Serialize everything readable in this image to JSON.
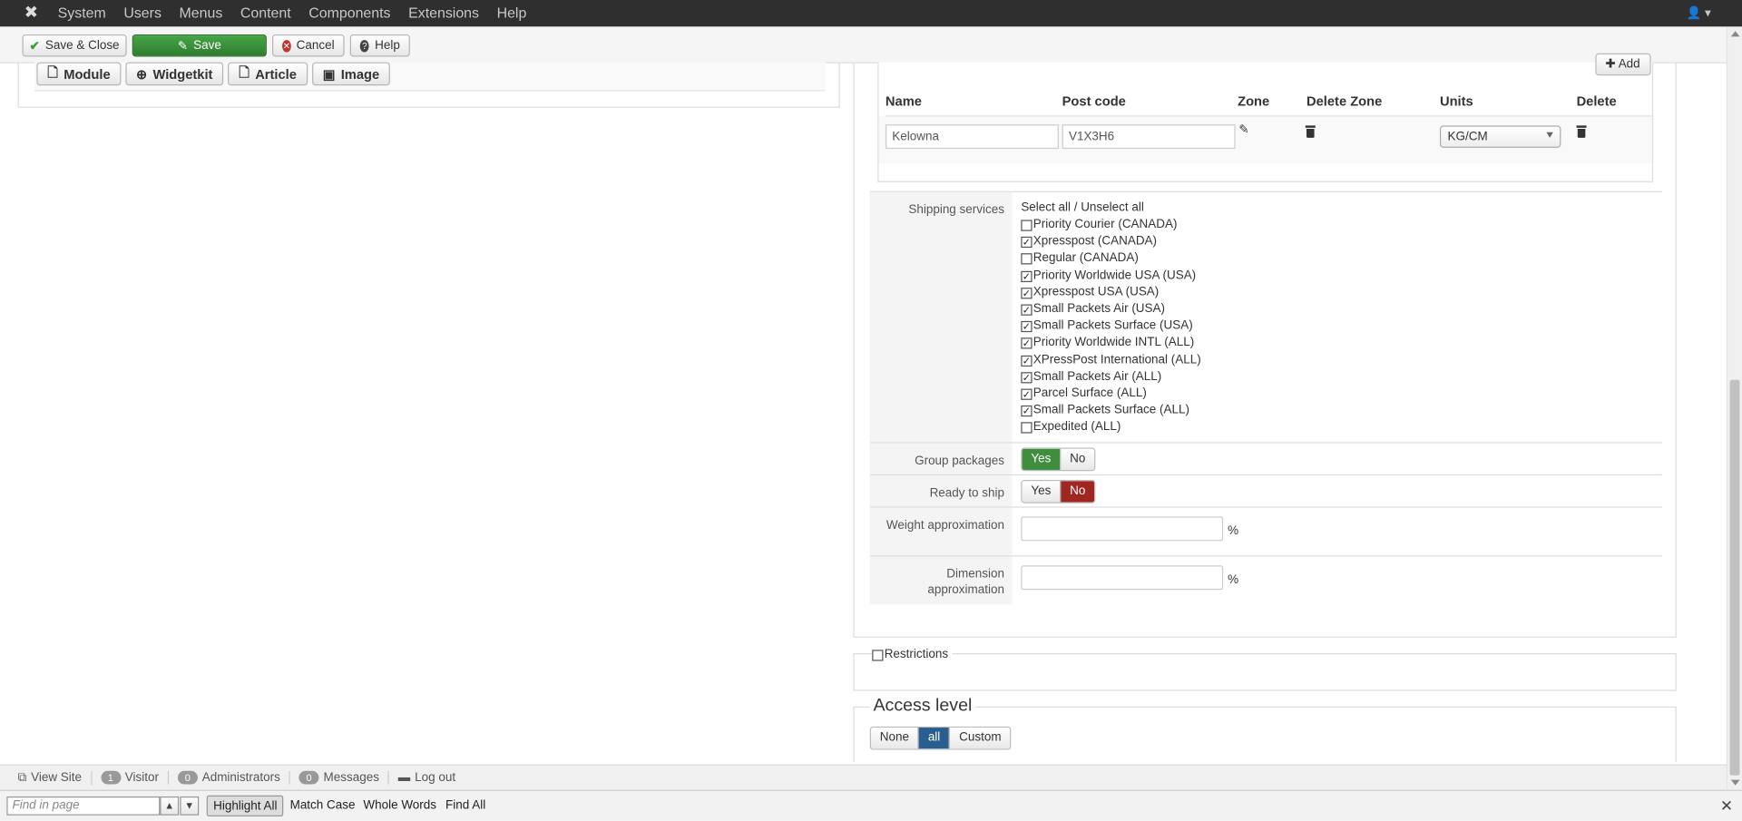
{
  "navbar": {
    "logo_glyph": "✖",
    "menu": [
      "System",
      "Users",
      "Menus",
      "Content",
      "Components",
      "Extensions",
      "Help"
    ],
    "user_glyph": "👤 ▾"
  },
  "toolbar": {
    "save_close": "Save & Close",
    "save": "Save",
    "cancel": "Cancel",
    "help": "Help"
  },
  "editor_buttons": [
    "Module",
    "Widgetkit",
    "Article",
    "Image"
  ],
  "zones": {
    "add_label": "Add",
    "headers": [
      "Name",
      "Post code",
      "Zone",
      "Delete Zone",
      "Units",
      "Delete"
    ],
    "row": {
      "name": "Kelowna",
      "postcode": "V1X3H6",
      "units": "KG/CM"
    }
  },
  "shipping": {
    "label": "Shipping services",
    "select_all": "Select all / Unselect all",
    "services": [
      {
        "label": "Priority Courier (CANADA)",
        "checked": false
      },
      {
        "label": "Xpresspost (CANADA)",
        "checked": true
      },
      {
        "label": "Regular (CANADA)",
        "checked": false
      },
      {
        "label": "Priority Worldwide USA (USA)",
        "checked": true
      },
      {
        "label": "Xpresspost USA (USA)",
        "checked": true
      },
      {
        "label": "Small Packets Air (USA)",
        "checked": true
      },
      {
        "label": "Small Packets Surface (USA)",
        "checked": true
      },
      {
        "label": "Priority Worldwide INTL (ALL)",
        "checked": true
      },
      {
        "label": "XPressPost International (ALL)",
        "checked": true
      },
      {
        "label": "Small Packets Air (ALL)",
        "checked": true
      },
      {
        "label": "Parcel Surface (ALL)",
        "checked": true
      },
      {
        "label": "Small Packets Surface (ALL)",
        "checked": true
      },
      {
        "label": "Expedited (ALL)",
        "checked": false
      }
    ]
  },
  "group_packages": {
    "label": "Group packages",
    "yes": "Yes",
    "no": "No",
    "selected": "Yes"
  },
  "ready_to_ship": {
    "label": "Ready to ship",
    "yes": "Yes",
    "no": "No",
    "selected": "No"
  },
  "weight_approx": {
    "label": "Weight approximation",
    "value": "",
    "unit": "%"
  },
  "dimension_approx": {
    "label": "Dimension approximation",
    "value": "",
    "unit": "%"
  },
  "restrictions": {
    "label": "Restrictions",
    "checked": false
  },
  "access_level": {
    "title": "Access level",
    "options": [
      "None",
      "all",
      "Custom"
    ],
    "selected": "all"
  },
  "statusbar": {
    "view_site": "View Site",
    "visitors_count": "1",
    "visitors_label": "Visitor",
    "admins_count": "0",
    "admins_label": "Administrators",
    "messages_count": "0",
    "messages_label": "Messages",
    "logout": "Log out"
  },
  "findbar": {
    "placeholder": "Find in page",
    "highlight_all": "Highlight All",
    "match_case": "Match Case",
    "whole_words": "Whole Words",
    "find_all": "Find All"
  }
}
